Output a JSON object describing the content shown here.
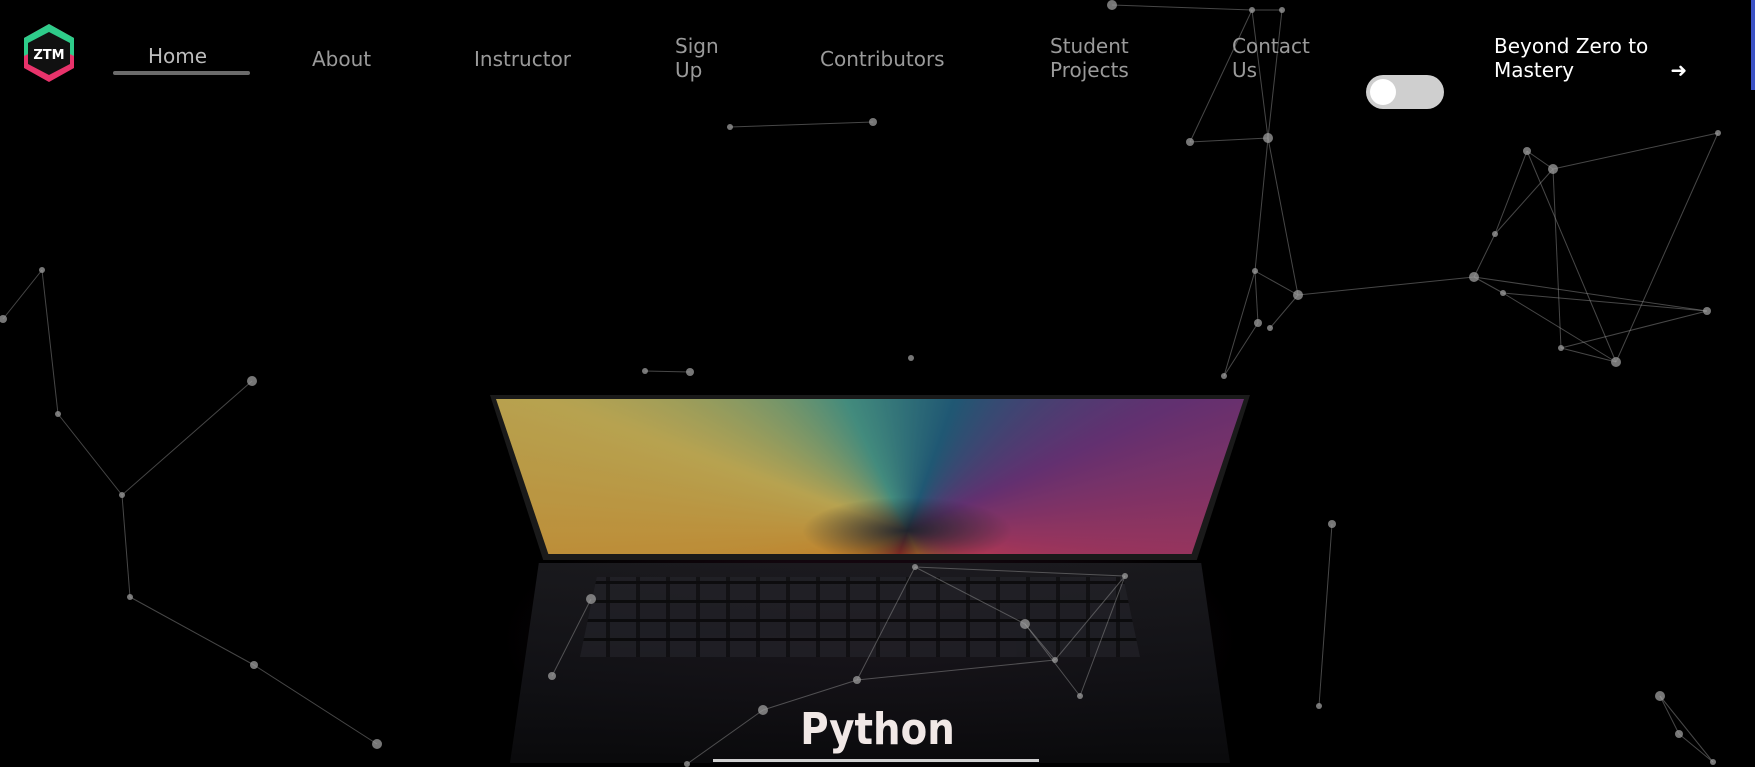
{
  "logo": {
    "text": "ZTM",
    "icon": "ztm-logo-icon",
    "colors": {
      "top": "#2ecc8a",
      "middle": "#111111",
      "bottom": "#e8336b"
    }
  },
  "nav": {
    "items": [
      {
        "label": "Home",
        "active": true
      },
      {
        "label": "About",
        "active": false
      },
      {
        "label": "Instructor",
        "active": false
      },
      {
        "label": "Sign Up",
        "active": false
      },
      {
        "label": "Contributors",
        "active": false
      },
      {
        "label": "Student Projects",
        "active": false
      },
      {
        "label": "Contact Us",
        "active": false
      }
    ],
    "theme_toggle": {
      "state": "off",
      "icon": "theme-toggle-icon"
    },
    "cta_label": "Beyond Zero to Mastery",
    "cta_icon": "arrow-right-icon"
  },
  "hero": {
    "title": "Python",
    "background": "laptop-photo"
  },
  "colors": {
    "background": "#000000",
    "nav_text": "#9a9a9a",
    "cta_text": "#ffffff",
    "particles": "#9e9e9e"
  }
}
